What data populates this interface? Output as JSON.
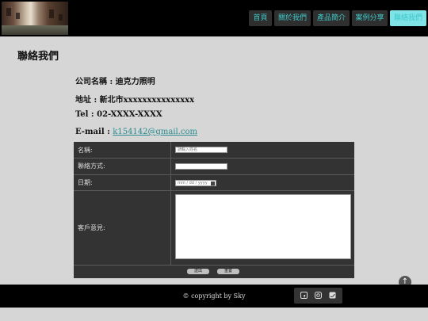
{
  "nav": {
    "items": [
      "首頁",
      "關於我們",
      "產品簡介",
      "案例分享",
      "聯絡我們"
    ],
    "active": "聯絡我們"
  },
  "page": {
    "title": "聯絡我們"
  },
  "company": {
    "name_line": "公司名稱 : 迪克力照明",
    "address_line": "地址 : 新北市xxxxxxxxxxxxxxx",
    "tel_line": "Tel : 02-XXXX-XXXX",
    "email_label": "E-mail : ",
    "email": "k154142@gmail.com"
  },
  "form": {
    "name_label": "名稱:",
    "name_placeholder": "請輸入姓名",
    "contact_label": "聯絡方式:",
    "date_label": "日期:",
    "date_placeholder": "mm / dd / yyyy",
    "comment_label": "客戶意見:",
    "submit_label": "送出",
    "reset_label": "重置"
  },
  "footer": {
    "copyright": "© copyright by Sky",
    "social_icons": [
      "facebook-icon",
      "instagram-icon",
      "twitter-icon"
    ]
  },
  "colors": {
    "accent": "#3ec9c9",
    "active_tab": "#7fe3e8",
    "link": "#2a8c8f",
    "form_bg": "#333333",
    "page_bg": "#d6d6d6"
  }
}
